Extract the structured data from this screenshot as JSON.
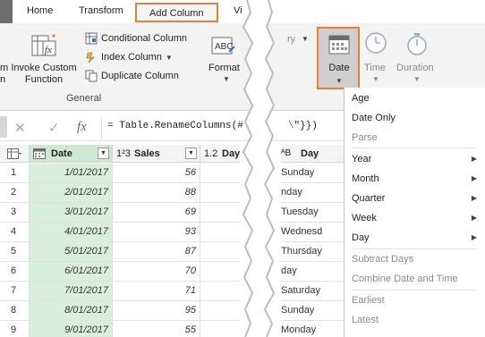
{
  "ribbon_tabs": {
    "home": "Home",
    "transform": "Transform",
    "add_column": "Add Column",
    "view_partial": "Vi"
  },
  "ribbon": {
    "custom_column_partial": "m\nn",
    "invoke_custom_function": "Invoke Custom\nFunction",
    "conditional_column": "Conditional Column",
    "index_column": "Index Column",
    "duplicate_column": "Duplicate Column",
    "general_group": "General",
    "format": "Format",
    "format_partial_right": "A",
    "ry_partial": "ry",
    "date": "Date",
    "time": "Time",
    "duration": "Duration"
  },
  "formula_bar": {
    "cancel_icon": "✕",
    "confirm_icon": "✓",
    "fx_icon": "fx",
    "text_left": "= Table.RenameColumns(#",
    "text_right": "\"}})"
  },
  "grid": {
    "headers": {
      "date": "Date",
      "sales_type": "1²3",
      "sales": "Sales",
      "day_type": "1.2",
      "day_partial": "Day",
      "day_right_type": "ᴬB",
      "day_right": "Day"
    },
    "rows": [
      {
        "n": "1",
        "date": "1/01/2017",
        "sales": "56",
        "day": "Sunday"
      },
      {
        "n": "2",
        "date": "2/01/2017",
        "sales": "88",
        "day": "nday"
      },
      {
        "n": "3",
        "date": "3/01/2017",
        "sales": "69",
        "day": "Tuesday"
      },
      {
        "n": "4",
        "date": "4/01/2017",
        "sales": "93",
        "day": "Wednesd"
      },
      {
        "n": "5",
        "date": "5/01/2017",
        "sales": "87",
        "day": "Thursday"
      },
      {
        "n": "6",
        "date": "6/01/2017",
        "sales": "70",
        "day": "day"
      },
      {
        "n": "7",
        "date": "7/01/2017",
        "sales": "71",
        "day": "Saturday"
      },
      {
        "n": "8",
        "date": "8/01/2017",
        "sales": "95",
        "day": "Sunday"
      },
      {
        "n": "9",
        "date": "9/01/2017",
        "sales": "55",
        "day": "Monday"
      }
    ]
  },
  "date_menu": {
    "age": "Age",
    "date_only": "Date Only",
    "parse": "Parse",
    "year": "Year",
    "month": "Month",
    "quarter": "Quarter",
    "week": "Week",
    "day": "Day",
    "subtract_days": "Subtract Days",
    "combine_date_time": "Combine Date and Time",
    "earliest": "Earliest",
    "latest": "Latest"
  },
  "colors": {
    "accent": "#ed7d31",
    "date_column_fill": "#d9efde",
    "disabled_text": "#8a8a8a"
  }
}
